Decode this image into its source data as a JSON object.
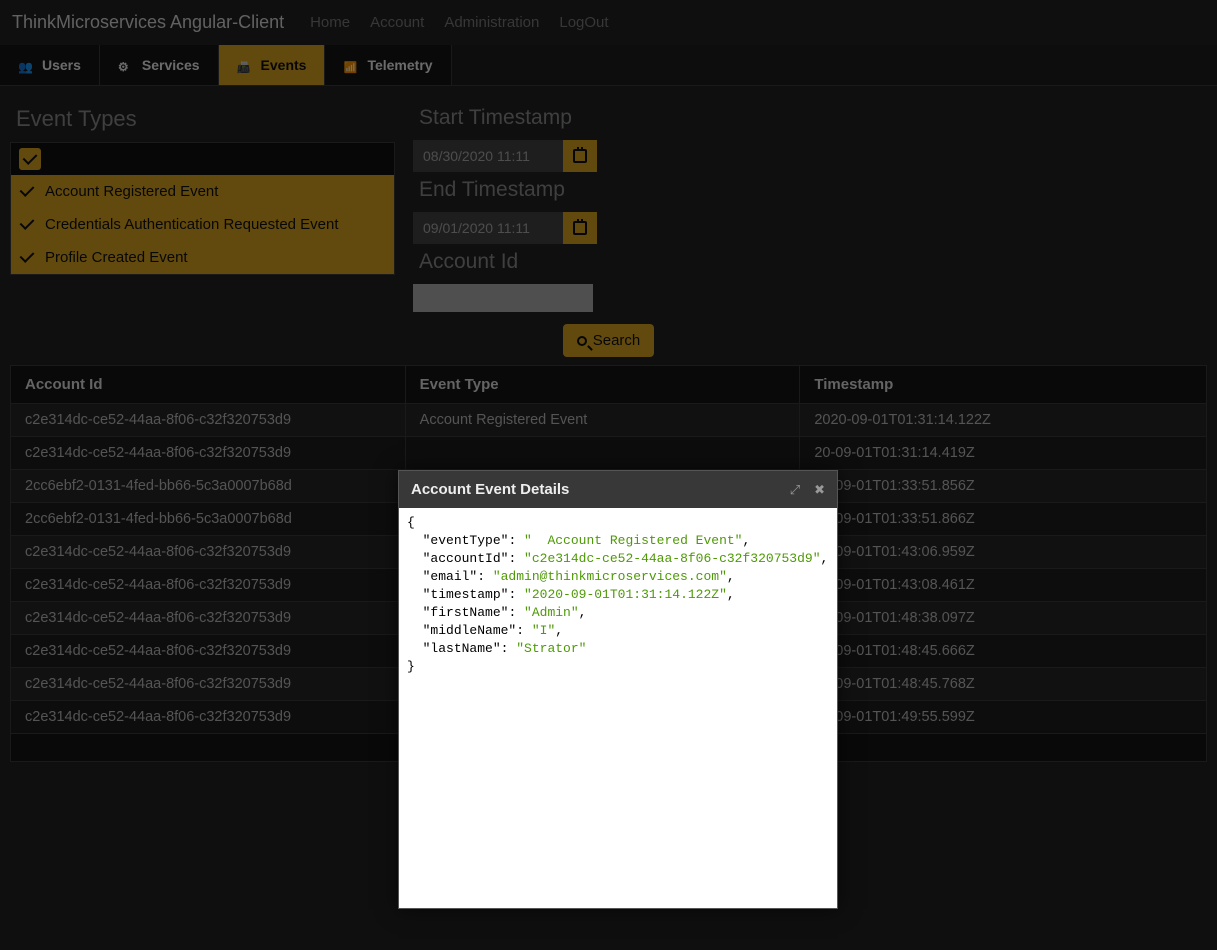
{
  "brand": "ThinkMicroservices Angular-Client",
  "nav": {
    "home": "Home",
    "account": "Account",
    "admin": "Administration",
    "logout": "LogOut"
  },
  "tabs": {
    "users": "Users",
    "services": "Services",
    "events": "Events",
    "telemetry": "Telemetry"
  },
  "filters": {
    "event_types_label": "Event Types",
    "event_types": [
      "Account Registered Event",
      "Credentials Authentication Requested Event",
      "Profile Created Event"
    ],
    "start_label": "Start Timestamp",
    "start_value": "08/30/2020 11:11",
    "end_label": "End Timestamp",
    "end_value": "09/01/2020 11:11",
    "account_label": "Account Id",
    "search_label": "Search"
  },
  "table": {
    "headers": [
      "Account Id",
      "Event Type",
      "Timestamp"
    ],
    "rows": [
      [
        "c2e314dc-ce52-44aa-8f06-c32f320753d9",
        "Account Registered Event",
        "2020-09-01T01:31:14.122Z"
      ],
      [
        "c2e314dc-ce52-44aa-8f06-c32f320753d9",
        "",
        "20-09-01T01:31:14.419Z"
      ],
      [
        "2cc6ebf2-0131-4fed-bb66-5c3a0007b68d",
        "",
        "20-09-01T01:33:51.856Z"
      ],
      [
        "2cc6ebf2-0131-4fed-bb66-5c3a0007b68d",
        "",
        "20-09-01T01:33:51.866Z"
      ],
      [
        "c2e314dc-ce52-44aa-8f06-c32f320753d9",
        "",
        "20-09-01T01:43:06.959Z"
      ],
      [
        "c2e314dc-ce52-44aa-8f06-c32f320753d9",
        "",
        "20-09-01T01:43:08.461Z"
      ],
      [
        "c2e314dc-ce52-44aa-8f06-c32f320753d9",
        "",
        "20-09-01T01:48:38.097Z"
      ],
      [
        "c2e314dc-ce52-44aa-8f06-c32f320753d9",
        "",
        "20-09-01T01:48:45.666Z"
      ],
      [
        "c2e314dc-ce52-44aa-8f06-c32f320753d9",
        "",
        "20-09-01T01:48:45.768Z"
      ],
      [
        "c2e314dc-ce52-44aa-8f06-c32f320753d9",
        "",
        "20-09-01T01:49:55.599Z"
      ]
    ]
  },
  "modal": {
    "title": "Account Event Details",
    "json": {
      "eventType": "  Account Registered Event",
      "accountId": "c2e314dc-ce52-44aa-8f06-c32f320753d9",
      "email": "admin@thinkmicroservices.com",
      "timestamp": "2020-09-01T01:31:14.122Z",
      "firstName": "Admin",
      "middleName": "I",
      "lastName": "Strator"
    }
  }
}
